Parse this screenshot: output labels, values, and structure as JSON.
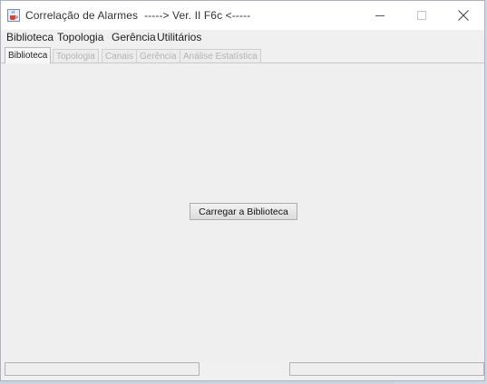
{
  "window": {
    "title": "Correlação de Alarmes  -----> Ver. II F6c <-----"
  },
  "menubar": {
    "items": [
      {
        "label": "Biblioteca"
      },
      {
        "label": "Topologia"
      },
      {
        "label": "Gerência"
      },
      {
        "label": "Utilitários"
      }
    ]
  },
  "tabs": [
    {
      "label": "Biblioteca",
      "active": true
    },
    {
      "label": "Topologia",
      "active": false
    },
    {
      "label": "Canais",
      "active": false
    },
    {
      "label": "Gerência",
      "active": false
    },
    {
      "label": "Análise Estatística",
      "active": false
    }
  ],
  "main": {
    "load_button_label": "Carregar a Biblioteca"
  },
  "icons": {
    "app": "java-coffee-cup-icon",
    "minimize": "minimize-icon",
    "maximize": "maximize-icon",
    "close": "close-icon"
  },
  "colors": {
    "window_bg": "#f0f0f0",
    "titlebar_bg": "#ffffff",
    "active_tab_text": "#1f1f1f",
    "inactive_tab_text": "#b4b4b4"
  }
}
